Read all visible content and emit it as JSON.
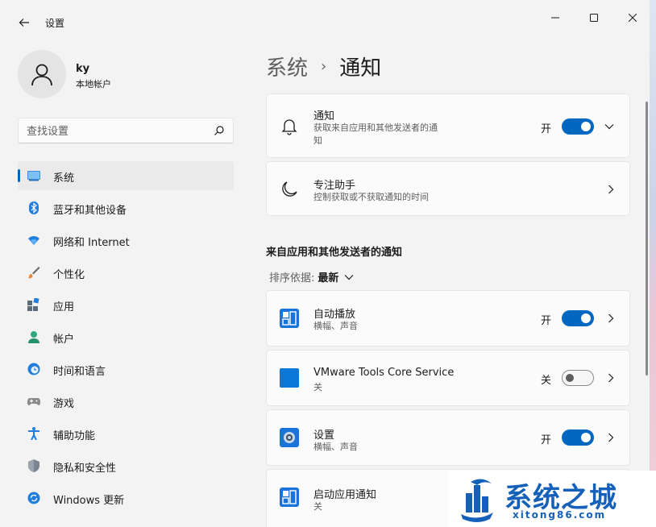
{
  "window": {
    "title": "设置"
  },
  "user": {
    "name": "ky",
    "account_type": "本地帐户"
  },
  "search": {
    "placeholder": "查找设置"
  },
  "nav": [
    {
      "label": "系统",
      "icon": "monitor-icon",
      "active": true
    },
    {
      "label": "蓝牙和其他设备",
      "icon": "bluetooth-icon"
    },
    {
      "label": "网络和 Internet",
      "icon": "wifi-icon"
    },
    {
      "label": "个性化",
      "icon": "brush-icon"
    },
    {
      "label": "应用",
      "icon": "apps-icon"
    },
    {
      "label": "帐户",
      "icon": "account-icon"
    },
    {
      "label": "时间和语言",
      "icon": "globe-clock-icon"
    },
    {
      "label": "游戏",
      "icon": "gamepad-icon"
    },
    {
      "label": "辅助功能",
      "icon": "accessibility-icon"
    },
    {
      "label": "隐私和安全性",
      "icon": "shield-icon"
    },
    {
      "label": "Windows 更新",
      "icon": "update-icon"
    }
  ],
  "breadcrumb": {
    "parent": "系统",
    "separator": "›",
    "current": "通知"
  },
  "notifications": {
    "title": "通知",
    "subtitle_line1": "获取来自应用和其他发送者的通",
    "subtitle_line2": "知",
    "state": "开"
  },
  "focus_assist": {
    "title": "专注助手",
    "subtitle": "控制获取或不获取通知的时间"
  },
  "section": {
    "title": "来自应用和其他发送者的通知"
  },
  "sort": {
    "label": "排序依据:",
    "value": "最新"
  },
  "apps": [
    {
      "name": "自动播放",
      "detail": "横幅、声音",
      "state": "开",
      "on": true
    },
    {
      "name": "VMware Tools Core Service",
      "detail": "关",
      "state": "关",
      "on": false
    },
    {
      "name": "设置",
      "detail": "横幅、声音",
      "state": "开",
      "on": true
    },
    {
      "name": "启动应用通知",
      "detail": "关"
    }
  ],
  "watermark": {
    "text": "系统之城",
    "url": "xitong86.com"
  },
  "colors": {
    "accent": "#0067c0",
    "background": "#f3f3f3",
    "card": "#fbfbfb"
  }
}
